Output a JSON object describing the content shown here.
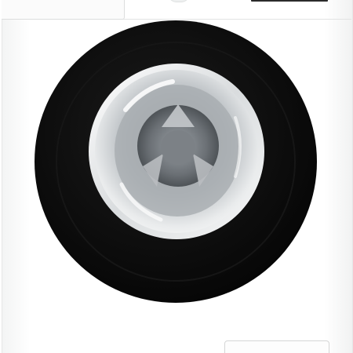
{
  "product": {
    "type": "front-loading washing machine",
    "colors": {
      "body": "#ffffff",
      "door_ring": "#0b0b0b",
      "glass": "#c9cdd0",
      "drum": "#6b6f73"
    }
  },
  "icons": {
    "door": "washer-door-icon",
    "drum": "drum-icon"
  }
}
